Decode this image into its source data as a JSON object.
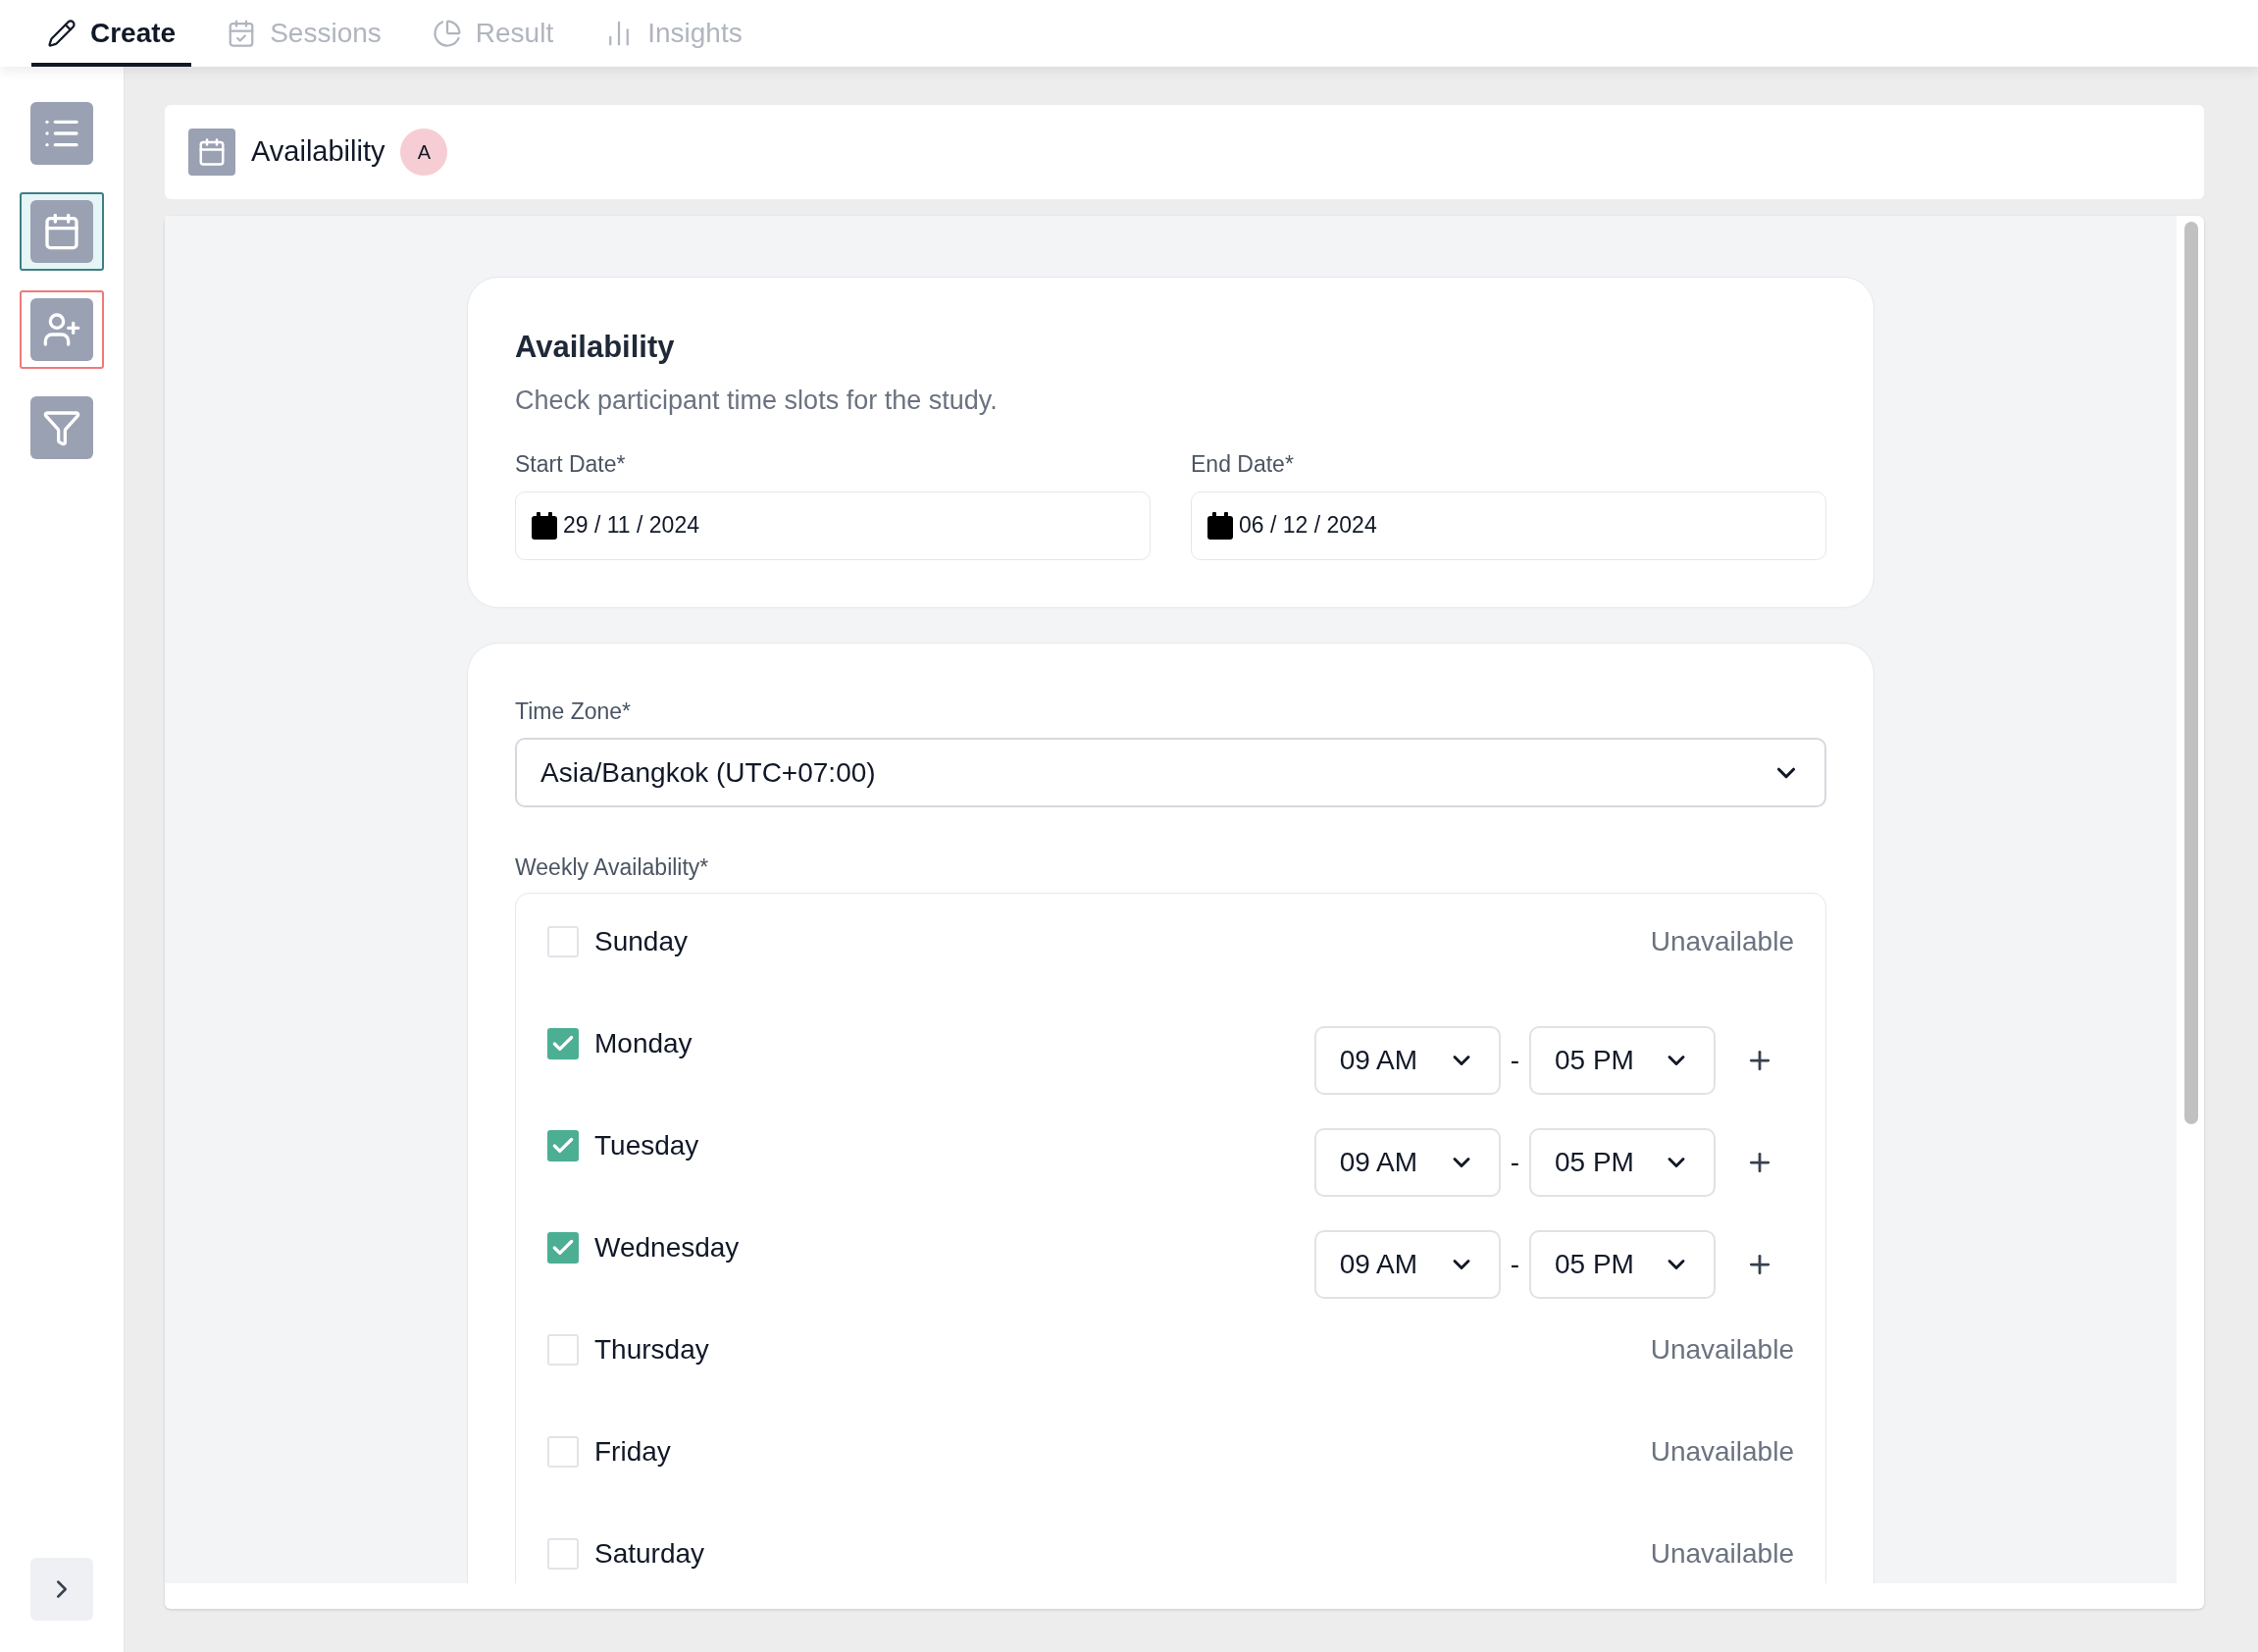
{
  "top_tabs": [
    {
      "label": "Create",
      "selected": true
    },
    {
      "label": "Sessions",
      "selected": false
    },
    {
      "label": "Result",
      "selected": false
    },
    {
      "label": "Insights",
      "selected": false
    }
  ],
  "sidebar": {
    "items": [
      {
        "selected": false,
        "error": false
      },
      {
        "selected": true,
        "error": false
      },
      {
        "selected": false,
        "error": true
      },
      {
        "selected": false,
        "error": false
      }
    ]
  },
  "header": {
    "title": "Availability",
    "badge": "A"
  },
  "dates_card": {
    "title": "Availability",
    "subtitle": "Check participant time slots for the study.",
    "fields": [
      {
        "label": "Start Date*",
        "value": "29 / 11 / 2024"
      },
      {
        "label": "End Date*",
        "value": "06 / 12 / 2024"
      }
    ]
  },
  "time_zone": {
    "label": "Time Zone*",
    "value": "Asia/Bangkok (UTC+07:00)"
  },
  "weekly": {
    "label": "Weekly Availability*",
    "separator": "-",
    "days": [
      {
        "name": "Sunday",
        "checked": false,
        "status": "Unavailable"
      },
      {
        "name": "Monday",
        "checked": true,
        "start": "09 AM",
        "end": "05 PM"
      },
      {
        "name": "Tuesday",
        "checked": true,
        "start": "09 AM",
        "end": "05 PM"
      },
      {
        "name": "Wednesday",
        "checked": true,
        "start": "09 AM",
        "end": "05 PM"
      },
      {
        "name": "Thursday",
        "checked": false,
        "status": "Unavailable"
      },
      {
        "name": "Friday",
        "checked": false,
        "status": "Unavailable"
      },
      {
        "name": "Saturday",
        "checked": false,
        "status": "Unavailable"
      }
    ]
  }
}
